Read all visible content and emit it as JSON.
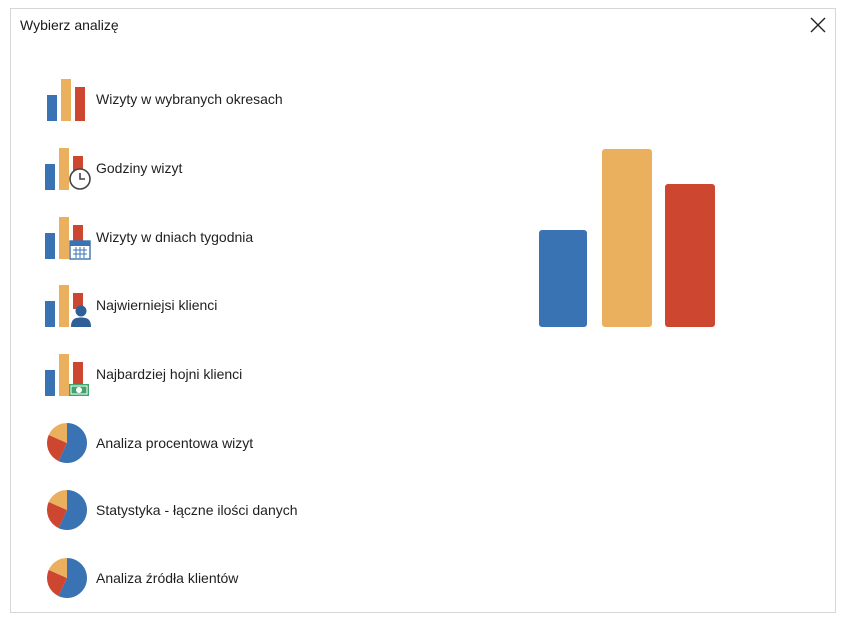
{
  "window": {
    "title": "Wybierz analizę"
  },
  "colors": {
    "blue": "#3A73B3",
    "orange": "#EBB05E",
    "red": "#CC4630"
  },
  "items": [
    {
      "label": "Wizyty w wybranych okresach",
      "icon": "bar-chart-icon"
    },
    {
      "label": "Godziny wizyt",
      "icon": "bar-chart-clock-icon"
    },
    {
      "label": "Wizyty w dniach tygodnia",
      "icon": "bar-chart-calendar-icon"
    },
    {
      "label": "Najwierniejsi klienci",
      "icon": "bar-chart-person-icon"
    },
    {
      "label": "Najbardziej hojni klienci",
      "icon": "bar-chart-money-icon"
    },
    {
      "label": "Analiza procentowa wizyt",
      "icon": "pie-chart-icon"
    },
    {
      "label": "Statystyka - łączne ilości danych",
      "icon": "pie-chart-icon"
    },
    {
      "label": "Analiza źródła klientów",
      "icon": "pie-chart-icon"
    }
  ]
}
